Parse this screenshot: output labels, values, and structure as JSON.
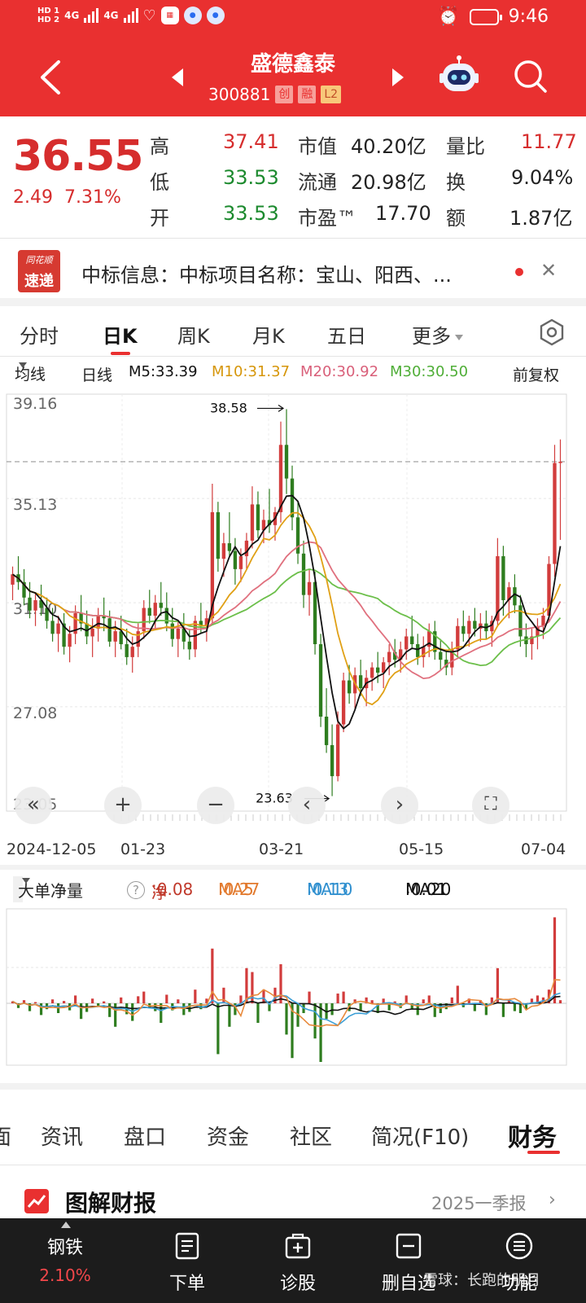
{
  "status_bar": {
    "time": "9:46",
    "net_a": "4G",
    "net_b": "4G",
    "hd_a": "HD 1",
    "hd_b": "HD 2"
  },
  "header": {
    "stock_name": "盛德鑫泰",
    "stock_code": "300881",
    "tags": [
      "创",
      "融",
      "L2"
    ]
  },
  "quote": {
    "price": "36.55",
    "change": "2.49",
    "change_pct": "7.31%",
    "rows": [
      {
        "l1": "高",
        "v1": "37.41",
        "l2": "市值",
        "v2": "40.20亿",
        "l3": "量比",
        "v3": "11.77"
      },
      {
        "l1": "低",
        "v1": "33.53",
        "l2": "流通",
        "v2": "20.98亿",
        "l3": "换",
        "v3": "9.04%"
      },
      {
        "l1": "开",
        "v1": "33.53",
        "l2": "市盈™",
        "v2": "17.70",
        "l3": "额",
        "v3": "1.87亿"
      }
    ]
  },
  "news": {
    "logo_top": "同花顺",
    "logo_bottom": "速递",
    "text": "中标信息：中标项目名称：宝山、阳西、..."
  },
  "period_tabs": [
    "分时",
    "日K",
    "周K",
    "月K",
    "五日",
    "更多"
  ],
  "ma_legend": {
    "type": "均线",
    "period": "日线",
    "m5": "M5:33.39",
    "m10": "M10:31.37",
    "m20": "M20:30.92",
    "m30": "M30:30.50",
    "adjust": "前复权"
  },
  "colors": {
    "accent": "#e93030",
    "up": "#d23c3c",
    "down": "#2e7d1f",
    "ma5": "#111111",
    "ma10": "#e0a015",
    "ma20": "#e0707e",
    "ma30": "#6cbf4a",
    "fund_ma5": "#e88a3c",
    "fund_ma10": "#3c9fd6"
  },
  "chart_data": [
    {
      "type": "candlestick",
      "title": "",
      "y_ticks": [
        "39.16",
        "35.13",
        "31.10",
        "27.08",
        "23.05"
      ],
      "ylim": [
        23.05,
        39.16
      ],
      "x_ticks": [
        "2024-12-05",
        "01-23",
        "03-21",
        "05-15",
        "07-04"
      ],
      "high_label": "38.58",
      "low_label": "23.63",
      "reference_price": "36.55",
      "grid": true,
      "ohlc": [
        [
          31.8,
          32.5,
          31.2,
          32.2
        ],
        [
          32.2,
          32.9,
          31.6,
          31.9
        ],
        [
          31.9,
          32.4,
          31.0,
          31.3
        ],
        [
          31.3,
          31.9,
          30.5,
          30.8
        ],
        [
          30.8,
          31.5,
          30.2,
          31.2
        ],
        [
          31.2,
          31.8,
          30.6,
          30.9
        ],
        [
          30.9,
          31.3,
          30.1,
          30.4
        ],
        [
          30.4,
          30.9,
          29.6,
          29.9
        ],
        [
          29.9,
          30.6,
          29.2,
          30.3
        ],
        [
          30.3,
          30.7,
          29.1,
          29.4
        ],
        [
          29.4,
          30.2,
          28.8,
          29.9
        ],
        [
          29.9,
          31.0,
          29.5,
          30.7
        ],
        [
          30.7,
          31.4,
          30.0,
          30.3
        ],
        [
          30.3,
          30.8,
          29.5,
          29.8
        ],
        [
          29.8,
          30.5,
          29.0,
          30.1
        ],
        [
          30.1,
          30.9,
          29.6,
          30.6
        ],
        [
          30.6,
          31.3,
          30.0,
          30.5
        ],
        [
          30.5,
          30.8,
          29.4,
          29.6
        ],
        [
          29.6,
          30.4,
          29.0,
          30.0
        ],
        [
          30.0,
          30.6,
          29.3,
          29.5
        ],
        [
          29.5,
          30.1,
          28.7,
          29.0
        ],
        [
          29.0,
          29.8,
          28.4,
          29.4
        ],
        [
          29.4,
          30.3,
          29.0,
          30.0
        ],
        [
          30.0,
          31.2,
          29.7,
          30.9
        ],
        [
          30.9,
          31.6,
          30.3,
          30.6
        ],
        [
          30.6,
          31.4,
          30.1,
          31.1
        ],
        [
          31.1,
          31.9,
          30.6,
          30.9
        ],
        [
          30.9,
          31.5,
          30.0,
          30.3
        ],
        [
          30.3,
          30.9,
          29.4,
          29.7
        ],
        [
          29.7,
          30.4,
          29.0,
          30.1
        ],
        [
          30.1,
          30.7,
          29.3,
          29.6
        ],
        [
          29.6,
          30.1,
          28.9,
          29.3
        ],
        [
          29.3,
          30.6,
          29.0,
          30.4
        ],
        [
          30.4,
          31.1,
          29.9,
          30.2
        ],
        [
          30.2,
          30.8,
          29.6,
          30.5
        ],
        [
          30.5,
          35.7,
          30.3,
          34.6
        ],
        [
          34.6,
          35.0,
          32.3,
          32.8
        ],
        [
          32.8,
          33.8,
          32.1,
          33.4
        ],
        [
          33.4,
          34.6,
          32.9,
          33.1
        ],
        [
          33.1,
          33.6,
          31.8,
          32.4
        ],
        [
          32.4,
          33.2,
          31.9,
          32.9
        ],
        [
          32.9,
          33.8,
          32.4,
          33.5
        ],
        [
          33.5,
          35.6,
          33.2,
          34.9
        ],
        [
          34.9,
          35.4,
          33.6,
          33.9
        ],
        [
          33.9,
          34.7,
          33.4,
          34.3
        ],
        [
          34.3,
          35.5,
          33.8,
          34.1
        ],
        [
          34.1,
          34.8,
          33.5,
          34.6
        ],
        [
          34.6,
          38.1,
          34.2,
          37.2
        ],
        [
          37.2,
          38.58,
          35.3,
          35.9
        ],
        [
          35.9,
          36.4,
          33.9,
          34.4
        ],
        [
          34.4,
          35.0,
          32.6,
          33.0
        ],
        [
          33.0,
          33.5,
          30.9,
          31.4
        ],
        [
          31.4,
          32.4,
          30.6,
          31.9
        ],
        [
          31.9,
          32.3,
          29.1,
          29.5
        ],
        [
          29.5,
          29.9,
          26.3,
          26.7
        ],
        [
          26.7,
          27.8,
          25.3,
          25.6
        ],
        [
          25.6,
          26.4,
          23.63,
          24.4
        ],
        [
          24.4,
          26.9,
          24.2,
          26.4
        ],
        [
          26.4,
          28.4,
          26.1,
          28.1
        ],
        [
          28.1,
          28.7,
          27.2,
          27.6
        ],
        [
          27.6,
          28.6,
          27.0,
          28.3
        ],
        [
          28.3,
          28.9,
          27.5,
          27.8
        ],
        [
          27.8,
          28.5,
          27.1,
          28.2
        ],
        [
          28.2,
          28.8,
          27.7,
          28.6
        ],
        [
          28.6,
          29.2,
          28.0,
          28.4
        ],
        [
          28.4,
          29.0,
          27.8,
          28.8
        ],
        [
          28.8,
          29.5,
          28.3,
          29.2
        ],
        [
          29.2,
          29.7,
          28.6,
          28.9
        ],
        [
          28.9,
          29.6,
          28.4,
          29.3
        ],
        [
          29.3,
          30.1,
          28.9,
          29.8
        ],
        [
          29.8,
          30.6,
          29.3,
          29.5
        ],
        [
          29.5,
          29.9,
          28.7,
          29.0
        ],
        [
          29.0,
          29.8,
          28.6,
          29.4
        ],
        [
          29.4,
          30.3,
          29.0,
          30.0
        ],
        [
          30.0,
          30.4,
          28.9,
          29.2
        ],
        [
          29.2,
          29.7,
          28.5,
          28.9
        ],
        [
          28.9,
          29.3,
          28.3,
          28.6
        ],
        [
          28.6,
          29.6,
          28.3,
          29.3
        ],
        [
          29.3,
          30.5,
          29.0,
          30.2
        ],
        [
          30.2,
          30.8,
          29.6,
          29.9
        ],
        [
          29.9,
          30.6,
          29.4,
          30.4
        ],
        [
          30.4,
          30.9,
          29.8,
          30.1
        ],
        [
          30.1,
          30.7,
          29.6,
          30.3
        ],
        [
          30.3,
          30.8,
          29.7,
          30.0
        ],
        [
          30.0,
          30.6,
          29.4,
          30.4
        ],
        [
          30.4,
          33.6,
          30.2,
          32.9
        ],
        [
          32.9,
          33.3,
          30.6,
          31.2
        ],
        [
          31.2,
          31.9,
          30.5,
          31.7
        ],
        [
          31.7,
          32.2,
          30.7,
          31.0
        ],
        [
          31.0,
          31.4,
          29.4,
          29.8
        ],
        [
          29.8,
          30.3,
          29.0,
          29.5
        ],
        [
          29.5,
          30.1,
          28.9,
          29.8
        ],
        [
          29.8,
          30.5,
          29.3,
          30.2
        ],
        [
          30.2,
          30.9,
          29.7,
          30.6
        ],
        [
          30.6,
          32.9,
          30.4,
          32.6
        ],
        [
          32.6,
          37.2,
          32.1,
          36.5
        ],
        [
          36.5,
          37.41,
          33.53,
          36.55
        ]
      ],
      "ma5_last": 33.39,
      "ma10_last": 31.37,
      "ma20_last": 30.92,
      "ma30_last": 30.5
    },
    {
      "type": "bar",
      "title": "大单净量",
      "series": [
        {
          "name": "净",
          "last": 0.08
        },
        {
          "name": "MA5",
          "last": 0.27
        },
        {
          "name": "MA10",
          "last": 0.13
        },
        {
          "name": "MA20",
          "last": 0.01
        }
      ],
      "values": [
        0.05,
        -0.12,
        0.08,
        -0.2,
        0.03,
        -0.3,
        -0.15,
        0.1,
        -0.25,
        0.06,
        -0.18,
        0.2,
        -0.4,
        -0.22,
        0.12,
        -0.08,
        0.05,
        -0.35,
        -0.6,
        0.15,
        -0.28,
        -0.45,
        0.18,
        0.3,
        -0.1,
        -0.2,
        -0.5,
        0.22,
        -0.18,
        0.1,
        -0.3,
        -0.22,
        0.35,
        -0.15,
        0.12,
        1.4,
        -1.3,
        0.4,
        -0.6,
        -0.3,
        0.2,
        0.9,
        0.8,
        -0.5,
        0.35,
        -0.2,
        0.4,
        1.0,
        -0.8,
        -1.4,
        -0.6,
        -0.25,
        0.3,
        -0.9,
        -1.5,
        -0.4,
        -0.3,
        0.25,
        0.3,
        -0.2,
        0.1,
        -0.2,
        0.15,
        0.08,
        -0.25,
        0.12,
        -0.18,
        0.05,
        -0.12,
        0.2,
        -0.15,
        -0.3,
        0.1,
        0.2,
        -0.35,
        -0.25,
        -0.15,
        0.15,
        0.45,
        -0.1,
        0.12,
        -0.2,
        0.08,
        -0.3,
        0.15,
        0.9,
        -0.35,
        0.1,
        -0.2,
        -0.25,
        -0.15,
        0.12,
        0.2,
        0.15,
        0.35,
        2.2,
        0.08
      ]
    }
  ],
  "section_tabs": [
    "面",
    "资讯",
    "盘口",
    "资金",
    "社区",
    "简况(F10)",
    "财务"
  ],
  "report": {
    "title": "图解财报",
    "period": "2025一季报"
  },
  "bottom_bar": {
    "sector_name": "钢铁",
    "sector_pct": "2.10%",
    "items": [
      "下单",
      "诊股",
      "删自选",
      "功能"
    ]
  },
  "watermark": "雪球：长跑的朋月"
}
